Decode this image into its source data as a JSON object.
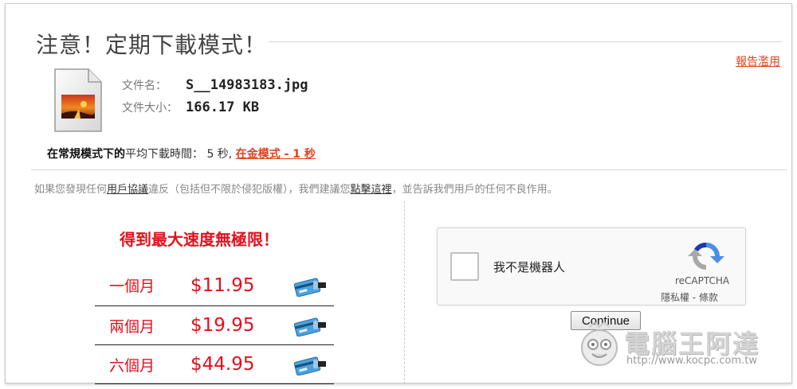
{
  "header": {
    "title": "注意！定期下載模式！",
    "report_link": "報告濫用"
  },
  "file": {
    "name_label": "文件名：",
    "name_value": "S__14983183.jpg",
    "size_label": "文件大小：",
    "size_value": "166.17 KB"
  },
  "speed": {
    "bold_text": "在常規模式下的",
    "rest_text": "平均下載時間： 5 秒, ",
    "gold_link": "在金模式 - 1 秒"
  },
  "notice": {
    "text_1": "如果您發現任何",
    "link_1": "用戶協議",
    "text_2": "違反（包括但不限於侵犯版權），我們建議您",
    "link_2": "點擊這裡",
    "text_3": "，並告訴我們用戶的任何不良作用。"
  },
  "promo": {
    "title": "得到最大速度無極限！",
    "plans": [
      {
        "name": "一個月",
        "price": "$11.95",
        "icon": "credit-card-icon"
      },
      {
        "name": "兩個月",
        "price": "$19.95",
        "icon": "credit-card-icon"
      },
      {
        "name": "六個月",
        "price": "$44.95",
        "icon": "credit-card-icon"
      }
    ]
  },
  "captcha": {
    "label": "我不是機器人",
    "brand": "reCAPTCHA",
    "links": "隱私權 - 條款"
  },
  "continue_button": "Continue",
  "watermark": {
    "text": "電腦王阿達",
    "url": "http://www.kocpc.com.tw"
  },
  "colors": {
    "accent_red": "#e2101c",
    "link_orange": "#e2401c"
  }
}
